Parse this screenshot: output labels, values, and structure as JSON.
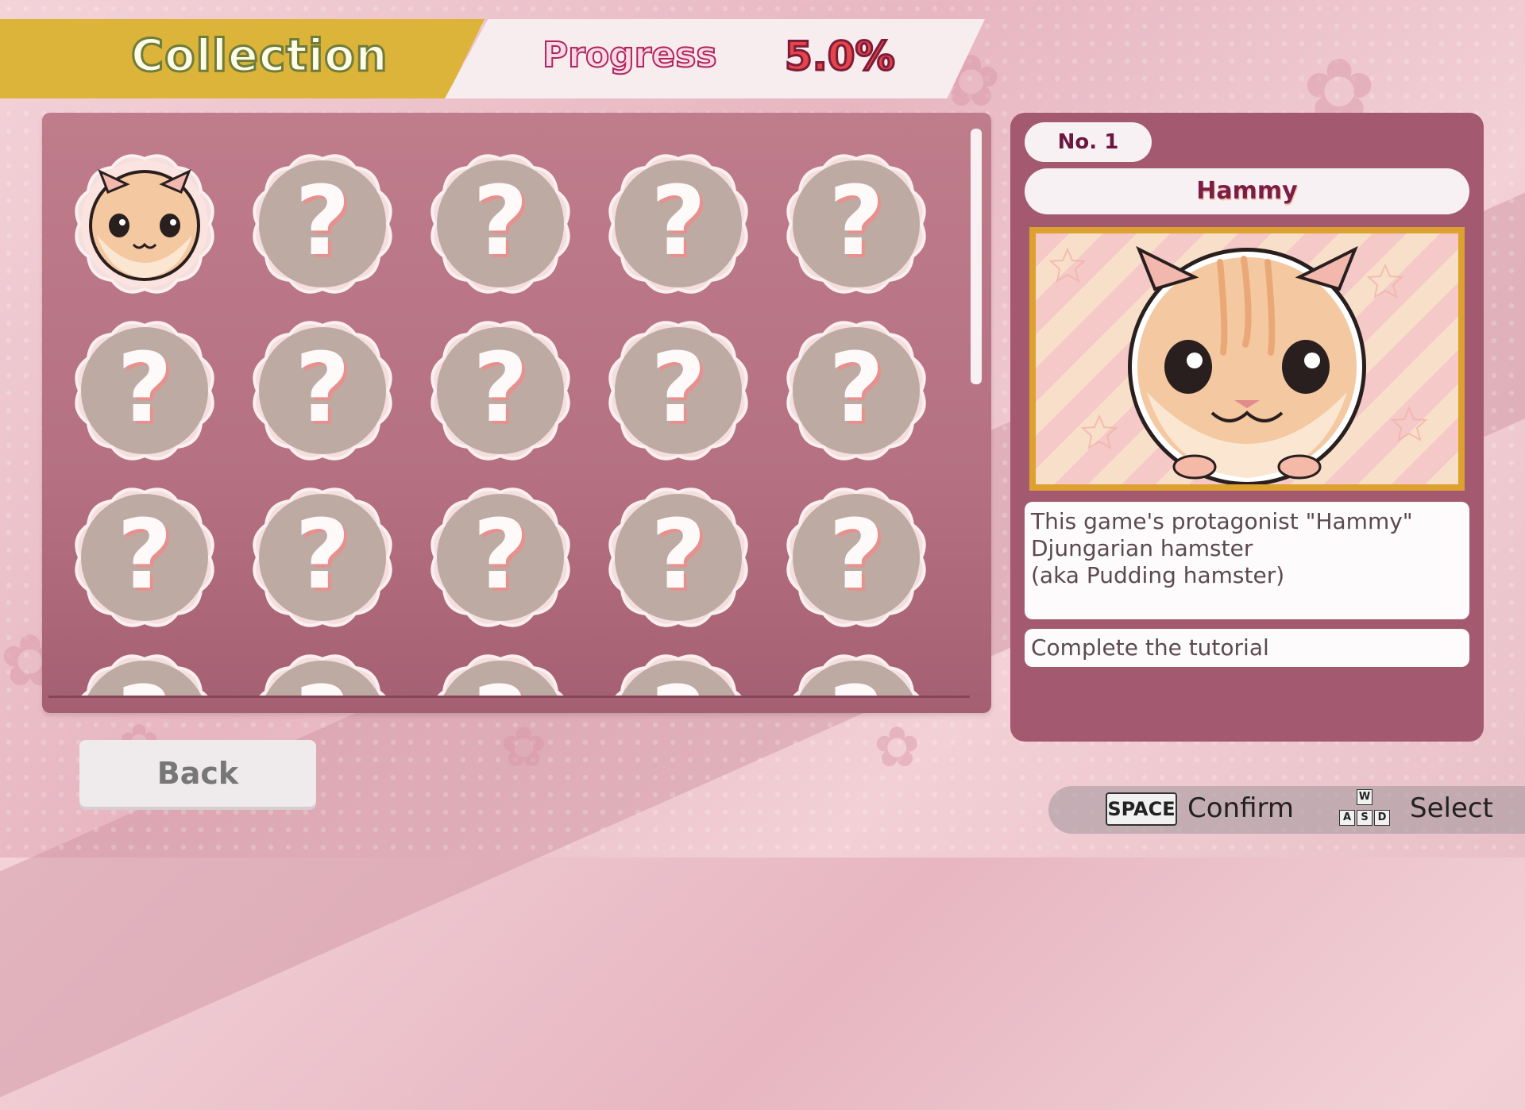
{
  "header": {
    "collection_title": "Collection",
    "progress_label": "Progress",
    "progress_value": "5.0%"
  },
  "grid": {
    "unlocked_character": "Hammy",
    "locked_symbol": "?",
    "rows": [
      [
        "unlocked",
        "locked",
        "locked",
        "locked",
        "locked"
      ],
      [
        "locked",
        "locked",
        "locked",
        "locked",
        "locked"
      ],
      [
        "locked",
        "locked",
        "locked",
        "locked",
        "locked"
      ],
      [
        "locked",
        "locked",
        "locked",
        "locked",
        "locked"
      ]
    ]
  },
  "detail": {
    "number": "No. 1",
    "name": "Hammy",
    "description": [
      "This game's protagonist \"Hammy\"",
      "Djungarian hamster",
      "(aka Pudding hamster)"
    ],
    "condition": "Complete the tutorial"
  },
  "buttons": {
    "back": "Back"
  },
  "controls": {
    "confirm_key": "SPACE",
    "confirm_label": "Confirm",
    "select_keys": [
      "W",
      "A",
      "S",
      "D"
    ],
    "select_label": "Select"
  },
  "colors": {
    "collection_tab": "#dcb43a",
    "panel": "#b57182",
    "detail_panel": "#a35a70",
    "medal_locked": "#bdaaa3",
    "frame_gold": "#dca12f"
  }
}
